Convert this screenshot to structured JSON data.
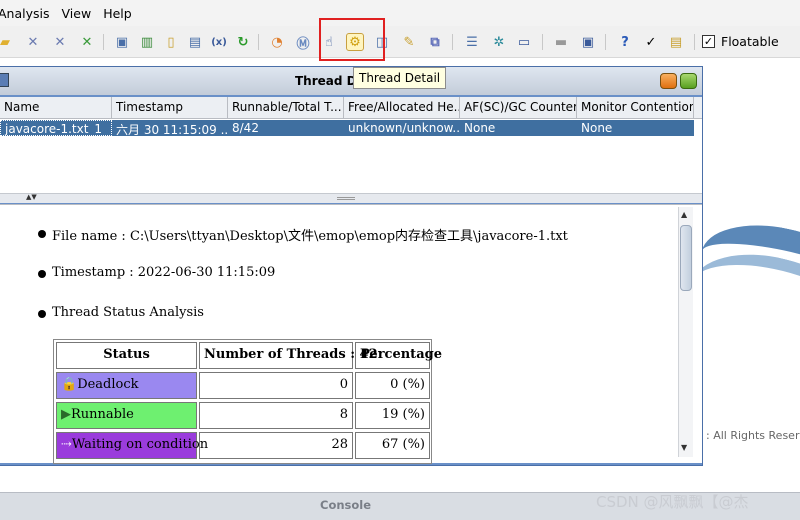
{
  "menu": [
    "Analysis",
    "View",
    "Help"
  ],
  "toolbar": {
    "floatable_label": "Floatable",
    "floatable_checked": "✓"
  },
  "window": {
    "title": "Thread Du",
    "tooltip": "Thread Detail"
  },
  "table": {
    "headers": [
      "Name",
      "Timestamp",
      "Runnable/Total T...",
      "Free/Allocated He...",
      "AF(SC)/GC Counter",
      "Monitor Contention"
    ],
    "row": [
      "javacore-1.txt_1",
      "六月 30 11:15:09 ...",
      "8/42",
      "unknown/unknow...",
      "None",
      "None"
    ]
  },
  "detail": {
    "file_name": "File name : C:\\Users\\ttyan\\Desktop\\文件\\emop\\emop内存检查工具\\javacore-1.txt",
    "timestamp": "Timestamp : 2022-06-30 11:15:09",
    "analysis_title": "Thread Status Analysis",
    "status_table": {
      "headers": [
        "Status",
        "Number of Threads : 42",
        "Percentage"
      ],
      "rows": [
        {
          "status": "Deadlock",
          "count": "0",
          "pct": "0 (%)",
          "color": "#9a88f0"
        },
        {
          "status": "Runnable",
          "count": "8",
          "pct": "19 (%)",
          "color": "#6ef070"
        },
        {
          "status": "Waiting on condition",
          "count": "28",
          "pct": "67 (%)",
          "color": "#9a3cdc"
        }
      ]
    }
  },
  "background": {
    "rights_text": ": All Rights Reserved",
    "console_title": "Console",
    "watermark": "CSDN @风飘飘【@杰"
  }
}
